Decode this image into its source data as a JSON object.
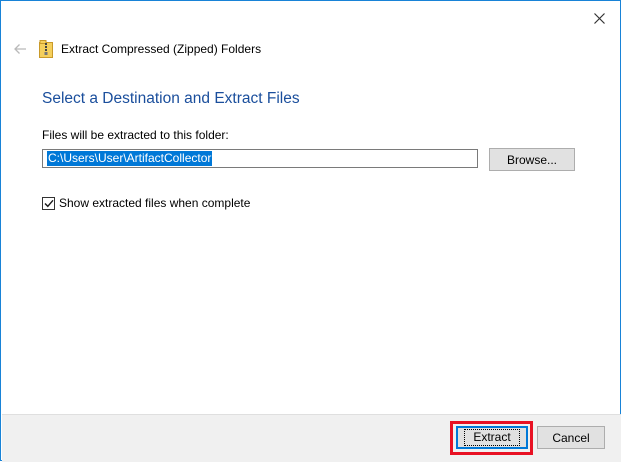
{
  "window": {
    "close_icon": "close-icon",
    "back_icon": "back-arrow-icon",
    "folder_icon": "zip-folder-icon",
    "title": "Extract Compressed (Zipped) Folders"
  },
  "main": {
    "heading": "Select a Destination and Extract Files",
    "field_label": "Files will be extracted to this folder:",
    "path_value": "C:\\Users\\User\\ArtifactCollector",
    "browse_label": "Browse...",
    "checkbox_label": "Show extracted files when complete",
    "checkbox_checked": true
  },
  "footer": {
    "extract_label": "Extract",
    "cancel_label": "Cancel"
  },
  "colors": {
    "accent": "#0078d7",
    "heading": "#1a4e9c",
    "highlight": "#e81123",
    "window_border": "#1883d7"
  }
}
